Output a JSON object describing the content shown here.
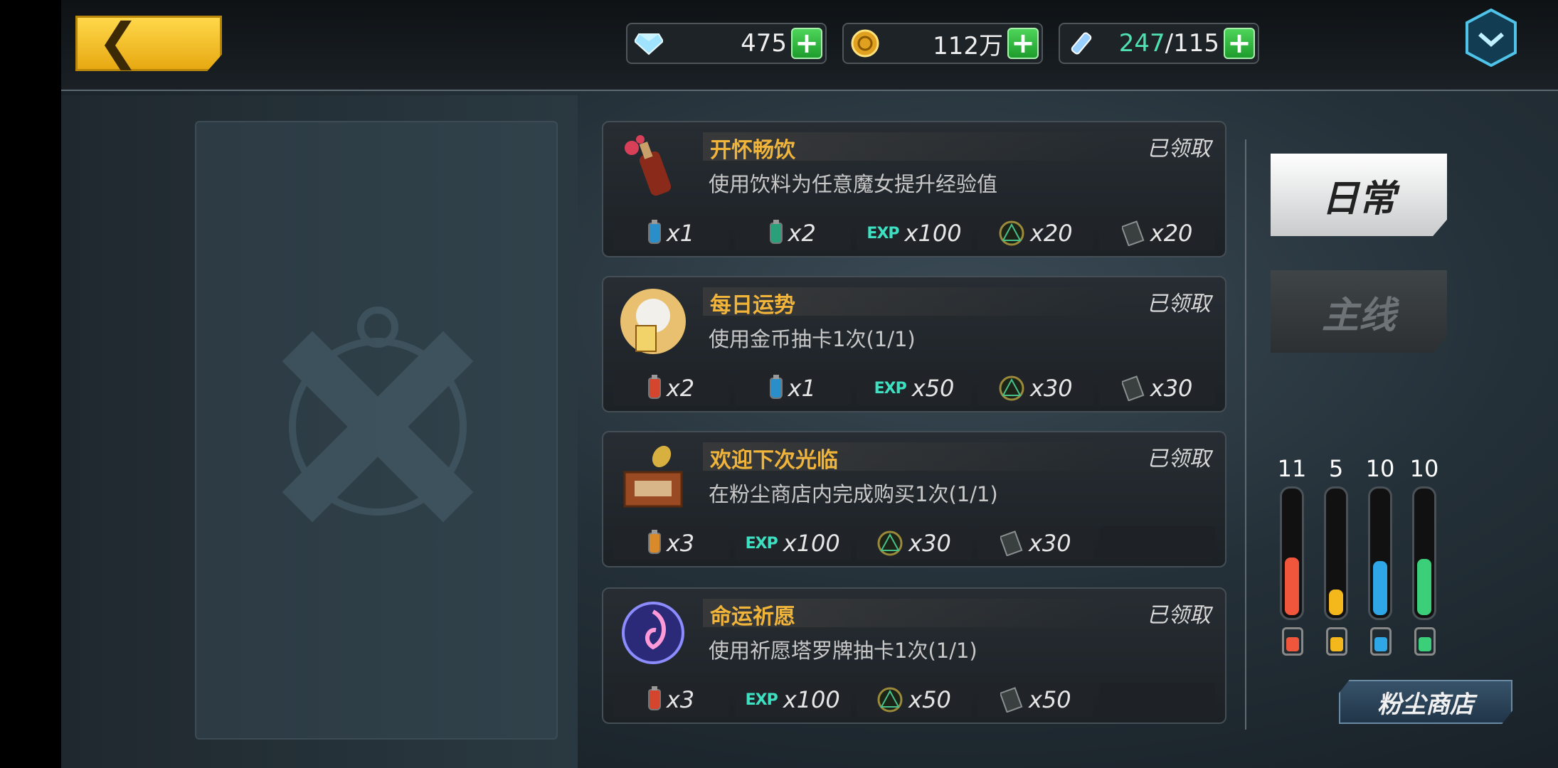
{
  "resources": {
    "diamonds": "475",
    "gold": "112万",
    "stamina_current": "247",
    "stamina_max": "/115"
  },
  "quests": [
    {
      "title": "开怀畅饮",
      "status": "已领取",
      "desc": "使用饮料为任意魔女提升经验值",
      "icon": "potion-bottle-icon",
      "rewards": [
        {
          "type": "blue-bottle",
          "label": "x1"
        },
        {
          "type": "green-bottle",
          "label": "x2"
        },
        {
          "type": "exp",
          "label": "x100"
        },
        {
          "type": "rune",
          "label": "x20"
        },
        {
          "type": "card",
          "label": "x20"
        }
      ]
    },
    {
      "title": "每日运势",
      "status": "已领取",
      "desc": "使用金币抽卡1次(1/1)",
      "icon": "lucky-cat-icon",
      "rewards": [
        {
          "type": "red-bottle",
          "label": "x2"
        },
        {
          "type": "blue-bottle",
          "label": "x1"
        },
        {
          "type": "exp",
          "label": "x50"
        },
        {
          "type": "rune",
          "label": "x30"
        },
        {
          "type": "card",
          "label": "x30"
        }
      ]
    },
    {
      "title": "欢迎下次光临",
      "status": "已领取",
      "desc": "在粉尘商店内完成购买1次(1/1)",
      "icon": "donation-box-icon",
      "rewards": [
        {
          "type": "orange-bottle",
          "label": "x3"
        },
        {
          "type": "exp",
          "label": "x100"
        },
        {
          "type": "rune",
          "label": "x30"
        },
        {
          "type": "card",
          "label": "x30"
        }
      ]
    },
    {
      "title": "命运祈愿",
      "status": "已领取",
      "desc": "使用祈愿塔罗牌抽卡1次(1/1)",
      "icon": "tarot-orb-icon",
      "rewards": [
        {
          "type": "red-bottle",
          "label": "x3"
        },
        {
          "type": "exp",
          "label": "x100"
        },
        {
          "type": "rune",
          "label": "x50"
        },
        {
          "type": "card",
          "label": "x50"
        }
      ]
    }
  ],
  "exp_label": "EXP",
  "tabs": {
    "daily": "日常",
    "main": "主线"
  },
  "gauges": [
    {
      "value": "11",
      "level": 0.45,
      "color": "#f0563c"
    },
    {
      "value": "5",
      "level": 0.2,
      "color": "#f5b81c"
    },
    {
      "value": "10",
      "level": 0.42,
      "color": "#2fa6e6"
    },
    {
      "value": "10",
      "level": 0.44,
      "color": "#3ccf7a"
    }
  ],
  "shop_button": "粉尘商店",
  "colors": {
    "accent_gold": "#f1b43a",
    "plus_green": "#2fbf3f",
    "title_orange": "#f1b43a"
  }
}
